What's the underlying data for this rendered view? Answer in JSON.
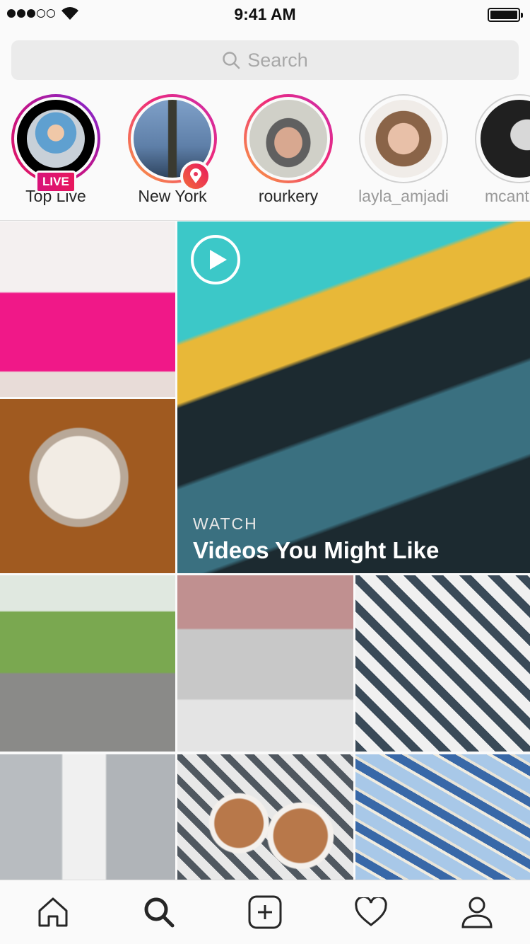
{
  "status_bar": {
    "time": "9:41 AM",
    "signal_bars": 3,
    "signal_total": 5,
    "battery_percent": 100
  },
  "search": {
    "placeholder": "Search"
  },
  "stories": [
    {
      "label": "Top Live",
      "badge": "LIVE",
      "ring": "live"
    },
    {
      "label": "New York",
      "badge": "location-pin-icon",
      "ring": "unseen"
    },
    {
      "label": "rourkery",
      "ring": "unseen"
    },
    {
      "label": "layla_amjadi",
      "ring": "seen"
    },
    {
      "label": "mcant",
      "ring": "seen"
    }
  ],
  "grid": {
    "video": {
      "kicker": "WATCH",
      "title": "Videos You Might Like",
      "icon": "play-icon"
    }
  },
  "tabs": [
    {
      "name": "home",
      "icon": "home-icon"
    },
    {
      "name": "search",
      "icon": "search-icon",
      "active": true
    },
    {
      "name": "new-post",
      "icon": "plus-square-icon"
    },
    {
      "name": "activity",
      "icon": "heart-icon"
    },
    {
      "name": "profile",
      "icon": "person-icon"
    }
  ],
  "colors": {
    "live": "#e8175d",
    "ring_start": "#f9a03f",
    "ring_end": "#c72cb0"
  }
}
